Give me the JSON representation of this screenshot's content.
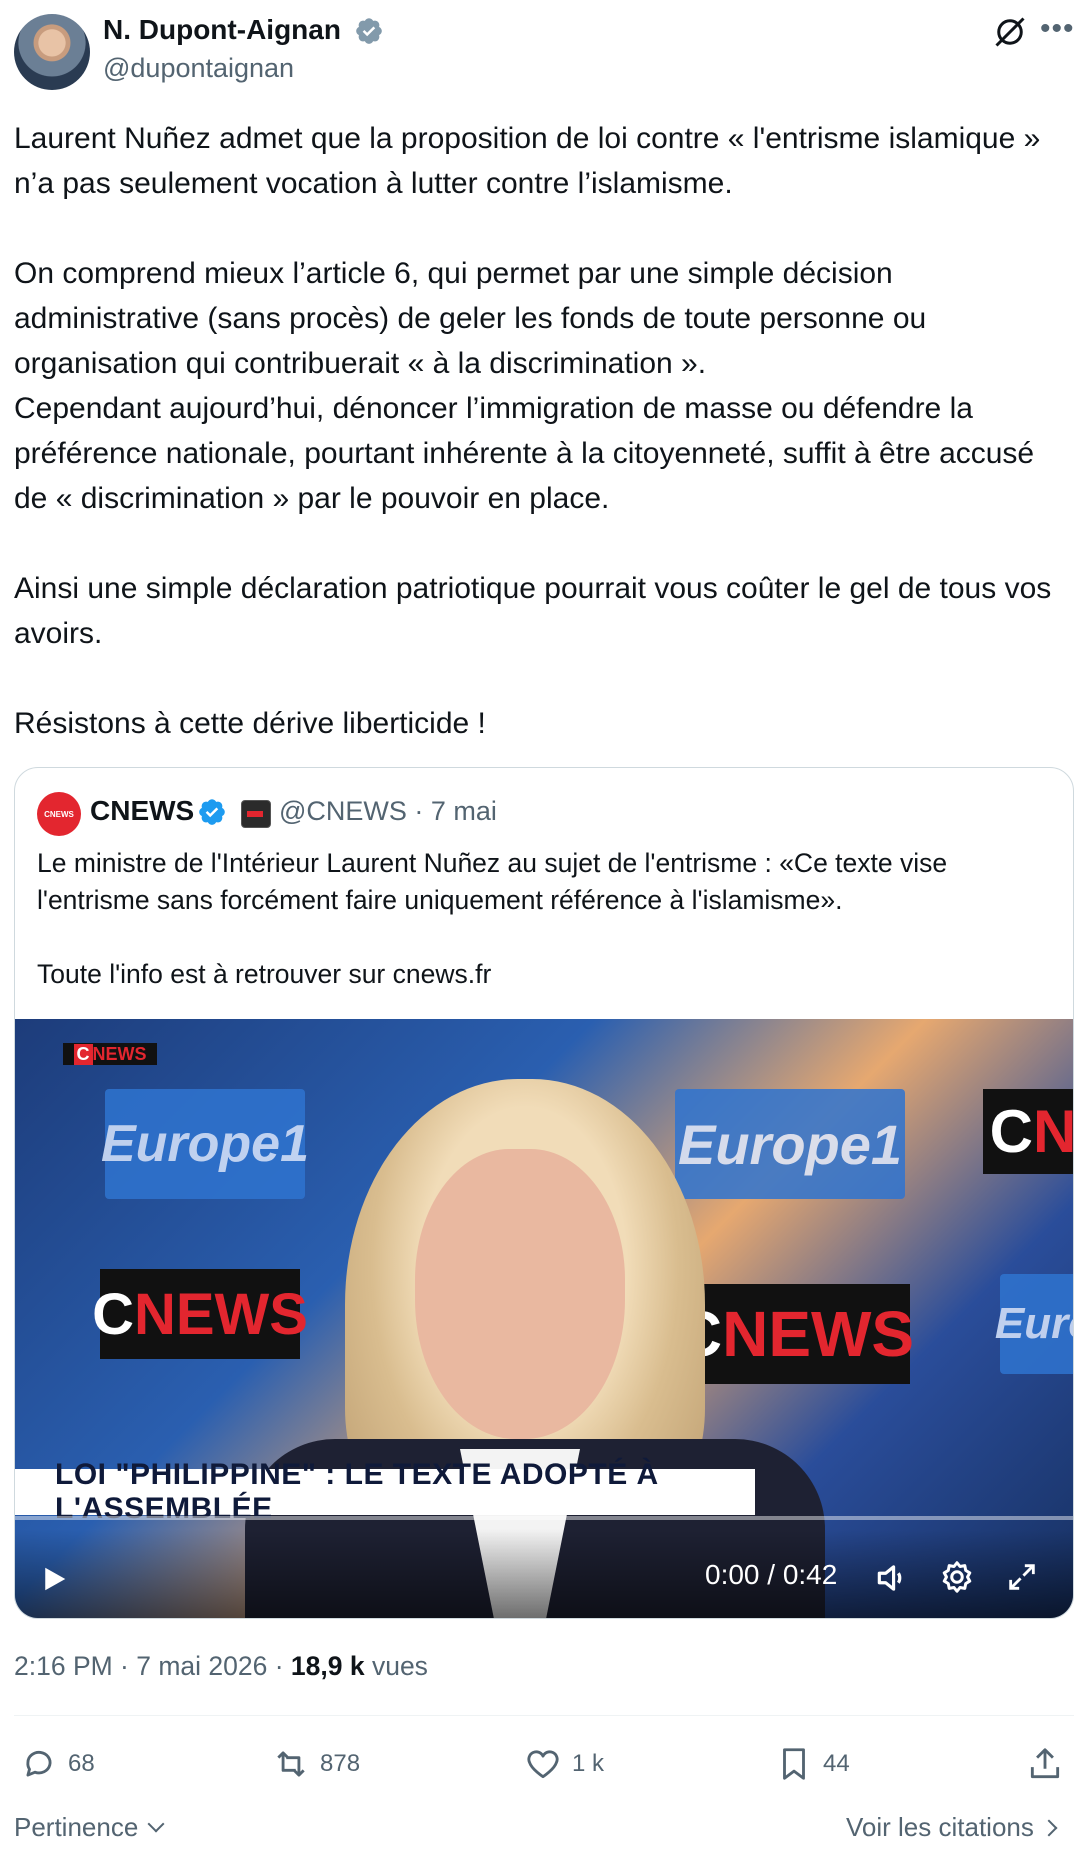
{
  "author": {
    "name": "N. Dupont-Aignan",
    "handle": "@dupontaignan"
  },
  "tweet": {
    "text": "Laurent Nuñez admet que la proposition de loi contre « l'entrisme islamique » n’a pas seulement vocation à lutter contre l’islamisme.\n\nOn comprend mieux l’article 6, qui permet par une simple décision administrative (sans procès) de geler les fonds de toute personne ou organisation qui contribuerait « à la discrimination ».\nCependant aujourd’hui, dénoncer l’immigration de masse ou défendre la préférence nationale, pourtant inhérente à la citoyenneté, suffit à être accusé de « discrimination » par le pouvoir en place.\n\nAinsi une simple déclaration patriotique pourrait vous coûter le gel de tous vos avoirs.\n\nRésistons à cette dérive liberticide !"
  },
  "quote": {
    "logo_text": "CNEWS",
    "name": "CNEWS",
    "handle_date": "@CNEWS · 7 mai",
    "text": "Le ministre de l'Intérieur Laurent Nuñez au sujet de l'entrisme : «Ce texte vise l'entrisme sans forcément faire uniquement référence à l'islamisme».\n\nToute l'info est à retrouver sur cnews.fr",
    "video": {
      "corner_logo": "NEWS",
      "panel_europe_left": "Europe1",
      "panel_europe_right": "Europe1",
      "panel_euro_partial": "Euro",
      "panel_cnews_left": "NEWS",
      "panel_cnews_right": "NEWS",
      "panel_cn_partial": "N",
      "banner": "LOI \"PHILIPPINE\" : LE TEXTE ADOPTÉ À L'ASSEMBLÉE",
      "timecode": "0:00 / 0:42"
    }
  },
  "meta": {
    "time_date": "2:16 PM · 7 mai 2026 · ",
    "views_count": "18,9 k",
    "views_label": " vues"
  },
  "actions": {
    "replies": "68",
    "reposts": "878",
    "likes": "1 k",
    "bookmarks": "44"
  },
  "footer": {
    "sort_label": "Pertinence",
    "quotes_link": "Voir les citations"
  },
  "colors": {
    "text": "#0f1419",
    "secondary": "#536471",
    "verified": "#1d9bf0",
    "cnews_red": "#e3262f",
    "border": "#cfd9de"
  }
}
